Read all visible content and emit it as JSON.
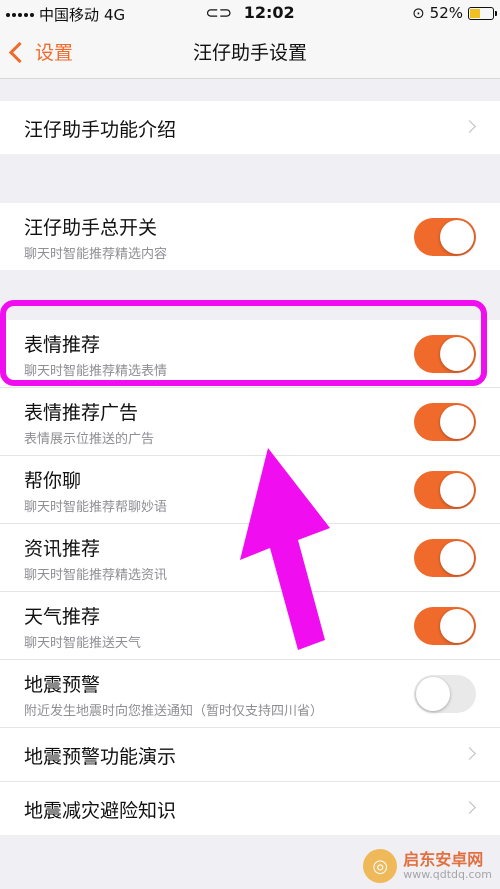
{
  "status": {
    "carrier": "中国移动",
    "network": "4G",
    "time": "12:02",
    "battery": "52%",
    "battery_level": 52
  },
  "nav": {
    "back_label": "设置",
    "title": "汪仔助手设置"
  },
  "intro": {
    "title": "汪仔助手功能介绍"
  },
  "master": {
    "title": "汪仔助手总开关",
    "sub": "聊天时智能推荐精选内容",
    "on": true
  },
  "features": [
    {
      "title": "表情推荐",
      "sub": "聊天时智能推荐精选表情",
      "on": true
    },
    {
      "title": "表情推荐广告",
      "sub": "表情展示位推送的广告",
      "on": true
    },
    {
      "title": "帮你聊",
      "sub": "聊天时智能推荐帮聊妙语",
      "on": true
    },
    {
      "title": "资讯推荐",
      "sub": "聊天时智能推荐精选资讯",
      "on": true
    },
    {
      "title": "天气推荐",
      "sub": "聊天时智能推送天气",
      "on": true
    },
    {
      "title": "地震预警",
      "sub": "附近发生地震时向您推送通知（暂时仅支持四川省）",
      "on": false
    }
  ],
  "links": [
    {
      "title": "地震预警功能演示"
    },
    {
      "title": "地震减灾避险知识"
    }
  ],
  "watermark": {
    "name": "启东安卓网",
    "url": "www.qdtdq.com"
  },
  "colors": {
    "accent": "#f06a2c",
    "highlight": "#f00ef0",
    "background": "#efeff4"
  }
}
